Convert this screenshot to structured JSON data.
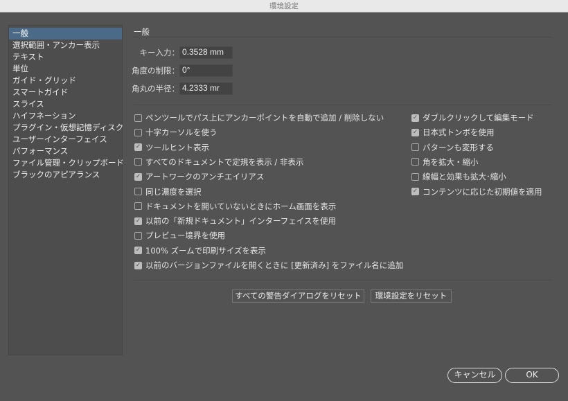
{
  "window": {
    "title": "環境設定"
  },
  "sidebar": {
    "items": [
      {
        "label": "一般",
        "selected": true
      },
      {
        "label": "選択範囲・アンカー表示"
      },
      {
        "label": "テキスト"
      },
      {
        "label": "単位"
      },
      {
        "label": "ガイド・グリッド"
      },
      {
        "label": "スマートガイド"
      },
      {
        "label": "スライス"
      },
      {
        "label": "ハイフネーション"
      },
      {
        "label": "プラグイン・仮想記憶ディスク"
      },
      {
        "label": "ユーザーインターフェイス"
      },
      {
        "label": "パフォーマンス"
      },
      {
        "label": "ファイル管理・クリップボード"
      },
      {
        "label": "ブラックのアピアランス"
      }
    ]
  },
  "main": {
    "heading": "一般",
    "fields": [
      {
        "label": "キー入力：",
        "value": "0.3528 mm"
      },
      {
        "label": "角度の制限：",
        "value": "0°"
      },
      {
        "label": "角丸の半径：",
        "value": "4.2333 mr"
      }
    ],
    "left_options": [
      {
        "label": "ペンツールでパス上にアンカーポイントを自動で追加 / 削除しない",
        "checked": false
      },
      {
        "label": "十字カーソルを使う",
        "checked": false
      },
      {
        "label": "ツールヒント表示",
        "checked": true
      },
      {
        "label": "すべてのドキュメントで定規を表示 / 非表示",
        "checked": false
      },
      {
        "label": "アートワークのアンチエイリアス",
        "checked": true
      },
      {
        "label": "同じ濃度を選択",
        "checked": false
      },
      {
        "label": "ドキュメントを開いていないときにホーム画面を表示",
        "checked": false
      },
      {
        "label": "以前の「新規ドキュメント」インターフェイスを使用",
        "checked": true
      },
      {
        "label": "プレビュー境界を使用",
        "checked": false
      },
      {
        "label": "100% ズームで印刷サイズを表示",
        "checked": true
      },
      {
        "label": "以前のバージョンファイルを開くときに [更新済み] をファイル名に追加",
        "checked": true
      }
    ],
    "right_options": [
      {
        "label": "ダブルクリックして編集モード",
        "checked": true
      },
      {
        "label": "日本式トンボを使用",
        "checked": true
      },
      {
        "label": "パターンも変形する",
        "checked": false
      },
      {
        "label": "角を拡大・縮小",
        "checked": false
      },
      {
        "label": "線幅と効果も拡大･縮小",
        "checked": false
      },
      {
        "label": "コンテンツに応じた初期値を適用",
        "checked": true
      }
    ],
    "reset_warnings_label": "すべての警告ダイアログをリセット",
    "reset_prefs_label": "環境設定をリセット"
  },
  "footer": {
    "cancel_label": "キャンセル",
    "ok_label": "OK"
  }
}
